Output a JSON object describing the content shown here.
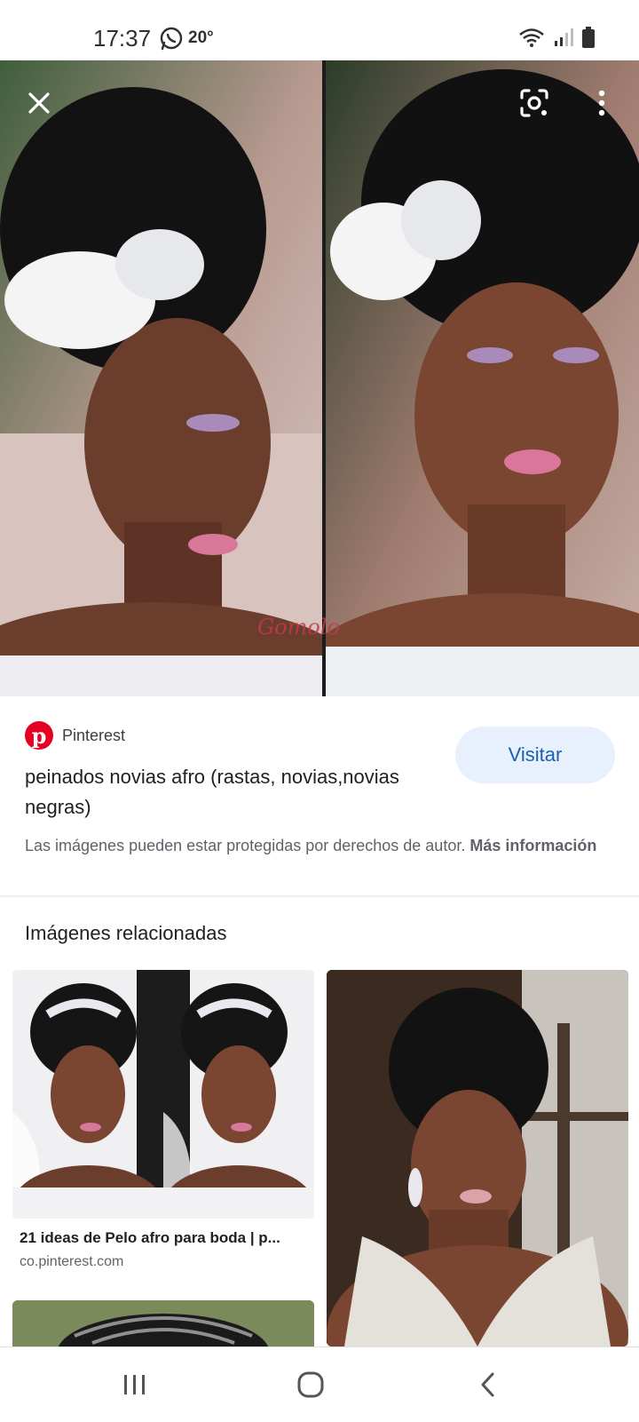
{
  "status_bar": {
    "time": "17:37",
    "temperature": "20°",
    "icons": [
      "whatsapp-icon",
      "wifi-icon",
      "signal-icon",
      "battery-icon"
    ]
  },
  "viewer": {
    "close_icon": "close-icon",
    "lens_icon": "lens-icon",
    "more_icon": "more-vert-icon",
    "watermark": "Gomolo"
  },
  "source": {
    "site": "Pinterest",
    "title": "peinados novias afro (rastas, novias,novias negras)",
    "visit_label": "Visitar",
    "copyright_text": "Las imágenes pueden estar protegidas por derechos de autor.",
    "more_info": "Más información"
  },
  "related": {
    "heading": "Imágenes relacionadas",
    "items": [
      {
        "caption": "21 ideas de Pelo afro para boda | p...",
        "domain": "co.pinterest.com"
      }
    ]
  },
  "nav": {
    "recents_icon": "recents-icon",
    "home_icon": "home-icon",
    "back_icon": "back-icon"
  },
  "colors": {
    "accent": "#1a5fb4",
    "visit_bg": "#e8f0fe",
    "pinterest_red": "#e60023"
  }
}
